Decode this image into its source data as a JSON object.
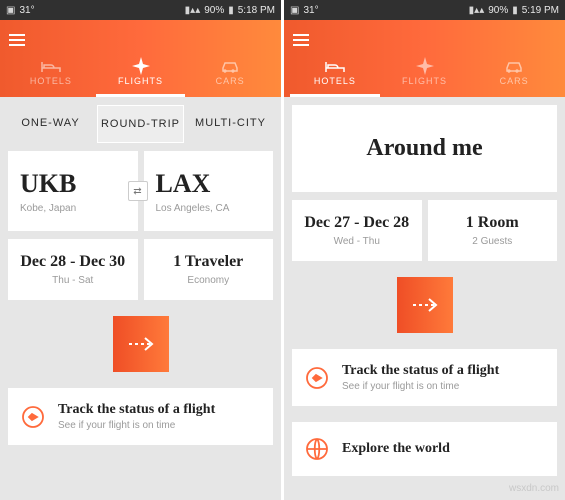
{
  "status": {
    "temp": "31°",
    "battery": "90%",
    "time_left": "5:18 PM",
    "time_right": "5:19 PM"
  },
  "header": {
    "tabs": {
      "hotels": "HOTELS",
      "flights": "FLIGHTS",
      "cars": "CARS"
    }
  },
  "flights": {
    "types": {
      "oneway": "ONE-WAY",
      "roundtrip": "ROUND-TRIP",
      "multicity": "MULTI-CITY"
    },
    "from_code": "UKB",
    "from_city": "Kobe, Japan",
    "to_code": "LAX",
    "to_city": "Los Angeles, CA",
    "dates": "Dec 28 - Dec 30",
    "dates_days": "Thu - Sat",
    "travelers": "1 Traveler",
    "travelers_class": "Economy",
    "track_title": "Track the status of a flight",
    "track_sub": "See if your flight is on time"
  },
  "hotels": {
    "around": "Around me",
    "dates": "Dec 27 - Dec 28",
    "dates_days": "Wed - Thu",
    "rooms": "1 Room",
    "guests": "2 Guests",
    "track_title": "Track the status of a flight",
    "track_sub": "See if your flight is on time",
    "explore_title": "Explore the world"
  },
  "watermark": "wsxdn.com"
}
